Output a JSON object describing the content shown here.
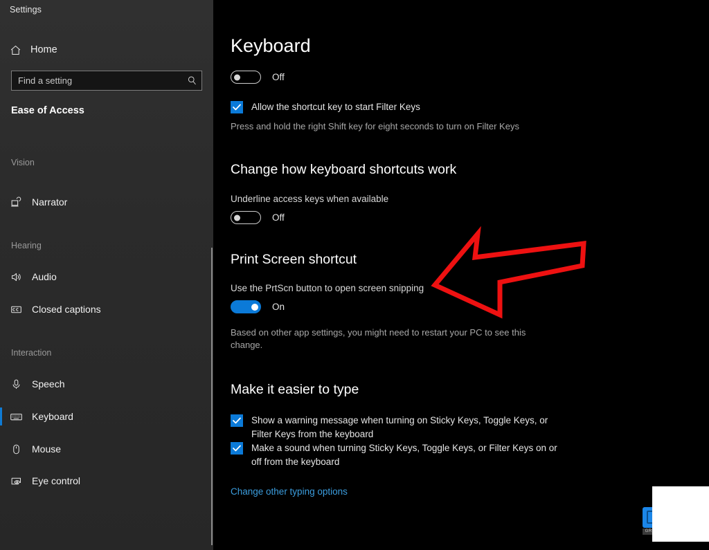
{
  "window": {
    "title": "Settings"
  },
  "sidebar": {
    "home_label": "Home",
    "home_icon": "home-icon",
    "search": {
      "placeholder": "Find a setting",
      "icon": "search-icon",
      "value": ""
    },
    "category_title": "Ease of Access",
    "groups": [
      {
        "label": "Vision"
      },
      {
        "label": "Hearing"
      },
      {
        "label": "Interaction"
      }
    ],
    "items": [
      {
        "label": "Narrator",
        "icon": "narrator-icon",
        "group": "Vision",
        "selected": false
      },
      {
        "label": "Audio",
        "icon": "audio-icon",
        "group": "Hearing",
        "selected": false
      },
      {
        "label": "Closed captions",
        "icon": "closed-captions-icon",
        "group": "Hearing",
        "selected": false
      },
      {
        "label": "Speech",
        "icon": "microphone-icon",
        "group": "Interaction",
        "selected": false
      },
      {
        "label": "Keyboard",
        "icon": "keyboard-icon",
        "group": "Interaction",
        "selected": true
      },
      {
        "label": "Mouse",
        "icon": "mouse-icon",
        "group": "Interaction",
        "selected": false
      },
      {
        "label": "Eye control",
        "icon": "eye-control-icon",
        "group": "Interaction",
        "selected": false
      }
    ]
  },
  "main": {
    "page_title": "Keyboard",
    "filter_keys": {
      "toggle_state": "Off",
      "toggle_on": false,
      "checkbox_label": "Allow the shortcut key to start Filter Keys",
      "checkbox_checked": true,
      "description": "Press and hold the right Shift key for eight seconds to turn on Filter Keys"
    },
    "shortcuts_section": {
      "heading": "Change how keyboard shortcuts work",
      "setting_label": "Underline access keys when available",
      "toggle_state": "Off",
      "toggle_on": false
    },
    "print_screen_section": {
      "heading": "Print Screen shortcut",
      "setting_label": "Use the PrtScn button to open screen snipping",
      "toggle_state": "On",
      "toggle_on": true,
      "description": "Based on other app settings, you might need to restart your PC to see this change."
    },
    "typing_section": {
      "heading": "Make it easier to type",
      "checkboxes": [
        {
          "label": "Show a warning message when turning on Sticky Keys, Toggle Keys, or Filter Keys from the keyboard",
          "checked": true
        },
        {
          "label": "Make a sound when turning Sticky Keys, Toggle Keys, or Filter Keys on or off from the keyboard",
          "checked": true
        }
      ],
      "link_label": "Change other typing options"
    }
  },
  "annotation": {
    "type": "arrow",
    "direction": "left",
    "color": "#ee1111",
    "points_at": "Use the PrtScn button to open screen snipping"
  },
  "overlay": {
    "taskbar_icon_label": "GRB",
    "accent_color": "#0b7ad8",
    "selection_color": "#0f7bd4",
    "link_color": "#3b9dde"
  }
}
